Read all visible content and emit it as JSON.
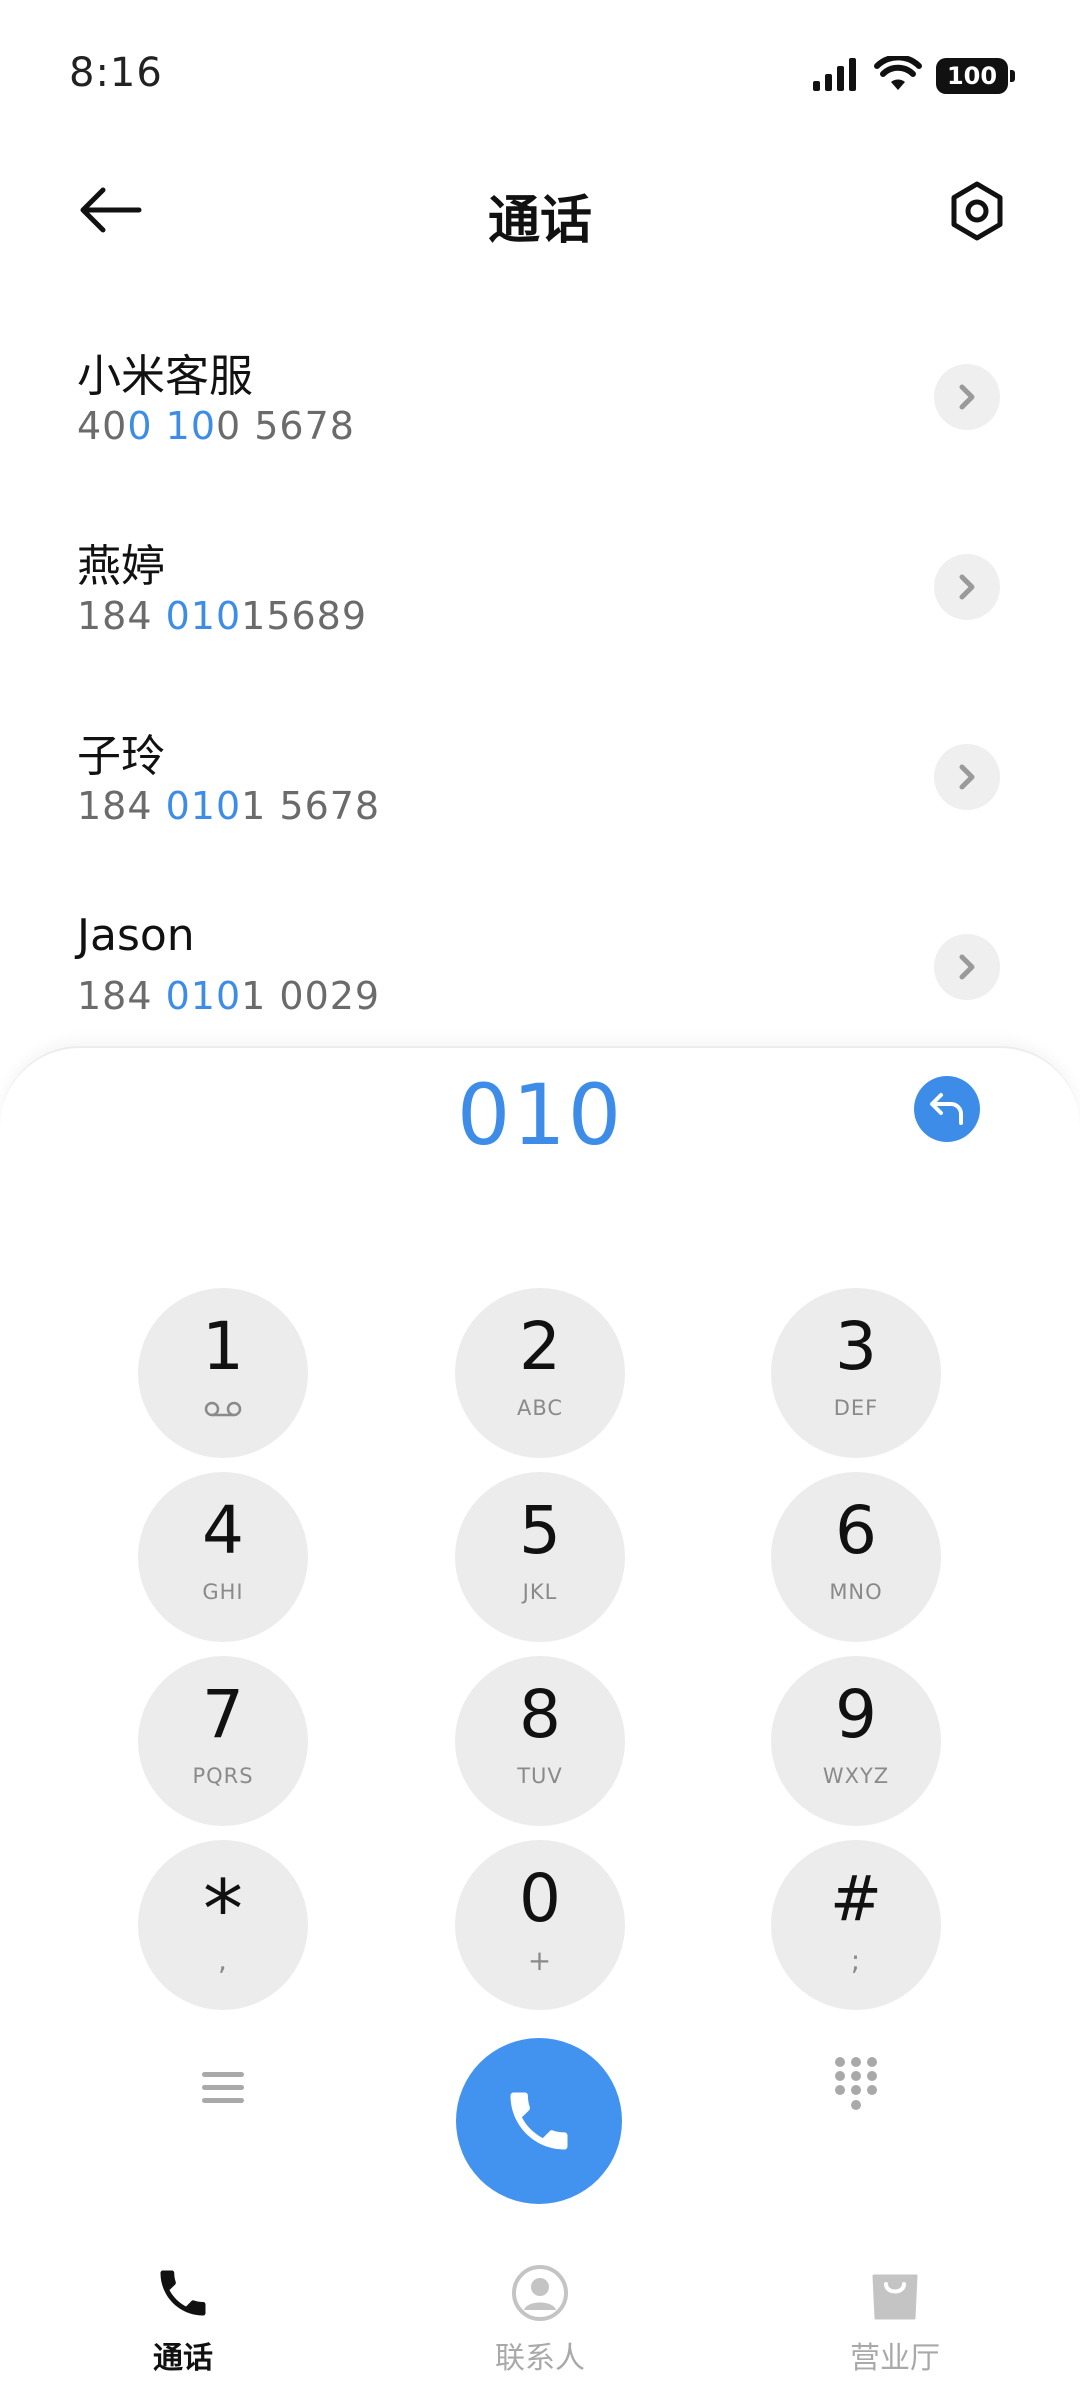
{
  "status": {
    "time": "8:16",
    "battery": "100"
  },
  "header": {
    "title": "通话"
  },
  "contacts": [
    {
      "name": "小米客服",
      "number_parts": [
        "40",
        "0",
        " ",
        "10",
        "0 5678"
      ]
    },
    {
      "name": "燕婷",
      "number_parts": [
        "184 ",
        "010",
        "15689"
      ]
    },
    {
      "name": "子玲",
      "number_parts": [
        "184 ",
        "010",
        "1 5678"
      ]
    },
    {
      "name": "Jason",
      "number_parts": [
        "184 ",
        "010",
        "1 0029"
      ]
    }
  ],
  "dialer": {
    "dialed": "010",
    "keys": [
      {
        "digit": "1",
        "letters": ""
      },
      {
        "digit": "2",
        "letters": "ABC"
      },
      {
        "digit": "3",
        "letters": "DEF"
      },
      {
        "digit": "4",
        "letters": "GHI"
      },
      {
        "digit": "5",
        "letters": "JKL"
      },
      {
        "digit": "6",
        "letters": "MNO"
      },
      {
        "digit": "7",
        "letters": "PQRS"
      },
      {
        "digit": "8",
        "letters": "TUV"
      },
      {
        "digit": "9",
        "letters": "WXYZ"
      },
      {
        "digit": "*",
        "letters": ","
      },
      {
        "digit": "0",
        "letters": "+"
      },
      {
        "digit": "#",
        "letters": ";"
      }
    ]
  },
  "nav": [
    {
      "label": "通话",
      "active": true
    },
    {
      "label": "联系人",
      "active": false
    },
    {
      "label": "营业厅",
      "active": false
    }
  ],
  "colors": {
    "accent": "#3d8de8",
    "call_button": "#4293ef",
    "key_bg": "#ececec",
    "muted": "#a9a9a9"
  }
}
